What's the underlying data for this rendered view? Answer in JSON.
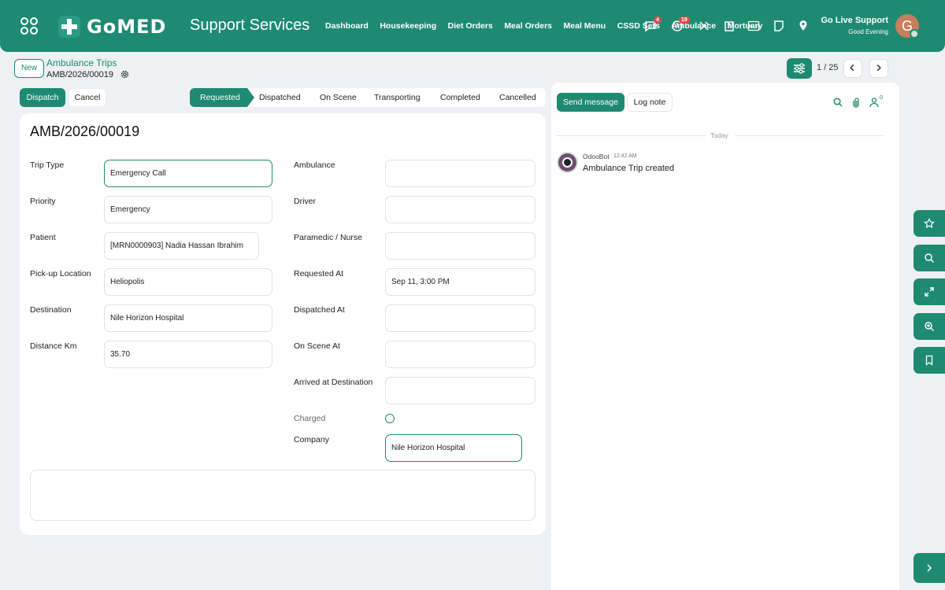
{
  "topbar": {
    "brand": "GoMED",
    "app_title": "Support Services",
    "nav": [
      "Dashboard",
      "Housekeeping",
      "Diet Orders",
      "Meal Orders",
      "Meal Menu",
      "CSSD Sets",
      "Ambulance",
      "Mortuary"
    ],
    "icons": [
      {
        "name": "chat-icon",
        "badge": "4"
      },
      {
        "name": "activity-icon",
        "badge": "19"
      },
      {
        "name": "tools-icon",
        "badge": ""
      },
      {
        "name": "building-icon",
        "badge": ""
      },
      {
        "name": "code-icon",
        "badge": ""
      },
      {
        "name": "note-icon",
        "badge": ""
      },
      {
        "name": "location-pin-icon",
        "badge": ""
      }
    ],
    "user_name": "Go Live Support",
    "user_greeting": "Good Evening",
    "avatar_initial": "G"
  },
  "control": {
    "new_label": "New",
    "breadcrumb_parent": "Ambulance Trips",
    "breadcrumb_current": "AMB/2026/00019",
    "pager": "1 / 25"
  },
  "actions": {
    "dispatch": "Dispatch",
    "cancel": "Cancel"
  },
  "statusbar": {
    "stages": [
      "Requested",
      "Dispatched",
      "On Scene",
      "Transporting",
      "Completed",
      "Cancelled"
    ],
    "active": "Requested"
  },
  "form": {
    "title": "AMB/2026/00019",
    "left_fields": [
      {
        "label": "Trip Type",
        "value": "Emergency Call"
      },
      {
        "label": "Priority",
        "value": "Emergency"
      },
      {
        "label": "Patient",
        "value": "[MRN0000903] Nadia Hassan Ibrahim"
      },
      {
        "label": "Pick-up Location",
        "value": "Heliopolis"
      },
      {
        "label": "Destination",
        "value": "Nile Horizon Hospital"
      },
      {
        "label": "Distance Km",
        "value": "35.70"
      }
    ],
    "right_fields": [
      {
        "label": "Ambulance",
        "value": ""
      },
      {
        "label": "Driver",
        "value": ""
      },
      {
        "label": "Paramedic / Nurse",
        "value": ""
      },
      {
        "label": "Requested At",
        "value": "Sep 11, 3:00 PM"
      },
      {
        "label": "Dispatched At",
        "value": ""
      },
      {
        "label": "On Scene At",
        "value": ""
      },
      {
        "label": "Arrived at Destination",
        "value": ""
      }
    ],
    "charged_label": "Charged",
    "charged": false,
    "company_label": "Company",
    "company_value": "Nile Horizon Hospital"
  },
  "chatter": {
    "send_message": "Send message",
    "log_note": "Log note",
    "followers_count": "0",
    "date_separator": "Today",
    "messages": [
      {
        "author": "OdooBot",
        "time": "12:42 AM",
        "body": "Ambulance Trip created"
      }
    ]
  },
  "colors": {
    "primary": "#1e8a72",
    "background": "#eef0f3",
    "badge": "#e04848"
  }
}
